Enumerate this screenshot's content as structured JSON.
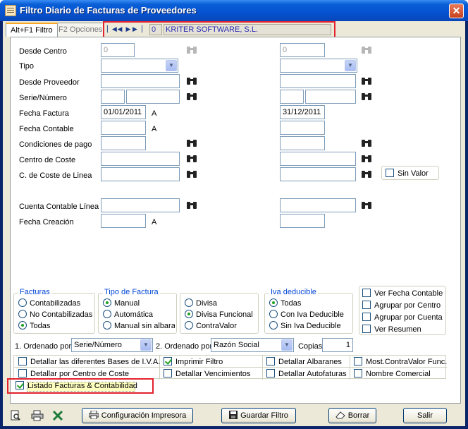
{
  "window": {
    "title": "Filtro Diario de Facturas de Proveedores",
    "close_glyph": "✕"
  },
  "tabs": [
    {
      "label": "Alt+F1 Filtro"
    },
    {
      "label": "F2 Opciones"
    }
  ],
  "navigator": {
    "record": "0",
    "company": "KRITER SOFTWARE, S.L."
  },
  "labels": {
    "desde_centro": "Desde Centro",
    "tipo": "Tipo",
    "desde_proveedor": "Desde Proveedor",
    "serie_numero": "Serie/Número",
    "fecha_factura": "Fecha Factura",
    "fecha_contable": "Fecha Contable",
    "condiciones_pago": "Condiciones de pago",
    "centro_coste": "Centro de Coste",
    "coste_linea": "C. de Coste de Linea",
    "cuenta_linea": "Cuenta Contable Línea",
    "fecha_creacion": "Fecha Creación",
    "a": "A"
  },
  "values": {
    "desde_centro": "0",
    "hasta_centro": "0",
    "fecha_factura_desde": "01/01/2011",
    "fecha_factura_hasta": "31/12/2011"
  },
  "sin_valor": "Sin Valor",
  "facturas": {
    "title": "Facturas",
    "options": [
      "Contabilizadas",
      "No Contabilizadas",
      "Todas"
    ],
    "selected": 2
  },
  "tipo_factura": {
    "title": "Tipo de Factura",
    "options": [
      "Manual",
      "Automática",
      "Manual sin albara"
    ],
    "selected": 0
  },
  "divisa": {
    "options": [
      "Divisa",
      "Divisa Funcional",
      "ContraValor"
    ],
    "selected": 1
  },
  "iva": {
    "title": "Iva deducible",
    "options": [
      "Todas",
      "Con Iva Deducible",
      "Sin Iva Deducible"
    ],
    "selected": 0
  },
  "right_checks": [
    "Ver Fecha Contable",
    "Agrupar por Centro",
    "Agrupar por Cuenta",
    "Ver Resumen"
  ],
  "order": {
    "label1": "1. Ordenado por",
    "value1": "Serie/Número",
    "label2": "2. Ordenado por",
    "value2": "Razón Social",
    "copias_label": "Copias",
    "copias": "1"
  },
  "options": {
    "detallar_bases": "Detallar las diferentes Bases de I.V.A.",
    "imprimir_filtro": "Imprimir Filtro",
    "detallar_albaranes": "Detallar Albaranes",
    "most_contravalor": "Most.ContraValor Func.",
    "detallar_centro": "Detallar por Centro de Coste",
    "detallar_vencimientos": "Detallar Vencimientos",
    "detallar_autofacturas": "Detallar Autofaturas",
    "nombre_comercial": "Nombre Comercial",
    "listado": "Listado Facturas & Contabilidad"
  },
  "buttons": {
    "config": "Configuración Impresora",
    "guardar": "Guardar Filtro",
    "borrar": "Borrar",
    "salir": "Salir"
  }
}
